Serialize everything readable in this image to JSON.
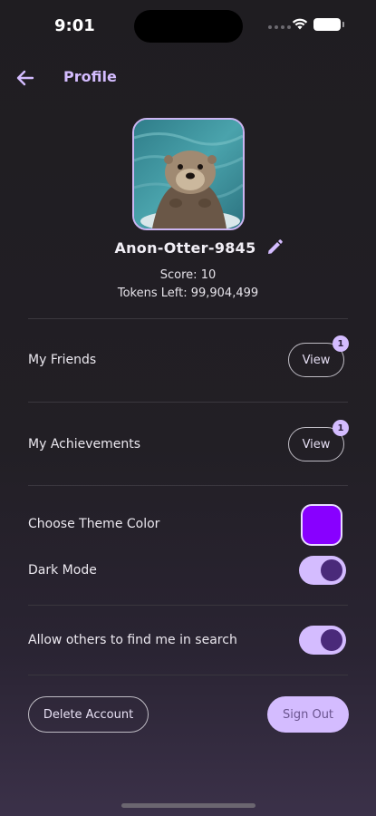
{
  "status_bar": {
    "time": "9:01"
  },
  "header": {
    "title": "Profile",
    "back_icon": "arrow-left-icon"
  },
  "profile": {
    "username": "Anon-Otter-9845",
    "score_label": "Score:",
    "score_value": "10",
    "tokens_label": "Tokens Left:",
    "tokens_value": "99,904,499",
    "edit_icon": "pencil-icon",
    "avatar": "sea-otter-photo"
  },
  "friends": {
    "label": "My Friends",
    "button": "View",
    "badge": "1"
  },
  "achievements": {
    "label": "My Achievements",
    "button": "View",
    "badge": "1"
  },
  "theme": {
    "label": "Choose Theme Color",
    "color": "#8800ff"
  },
  "dark_mode": {
    "label": "Dark Mode",
    "on": true
  },
  "search": {
    "label": "Allow others to find me in search",
    "on": true
  },
  "actions": {
    "delete": "Delete Account",
    "sign_out": "Sign Out"
  },
  "colors": {
    "accent": "#d4bcff",
    "background": "#1f1d21",
    "toggle_knob": "#4a2a7a"
  }
}
